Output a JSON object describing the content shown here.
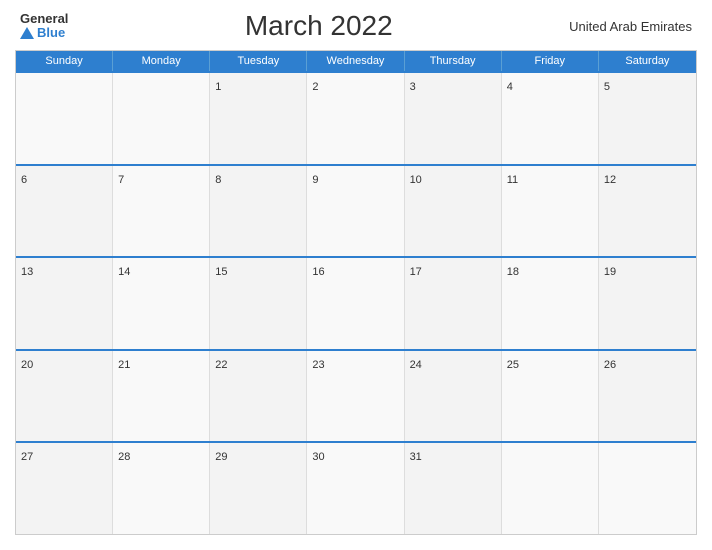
{
  "header": {
    "logo_general": "General",
    "logo_blue": "Blue",
    "title": "March 2022",
    "country": "United Arab Emirates"
  },
  "days_of_week": [
    "Sunday",
    "Monday",
    "Tuesday",
    "Wednesday",
    "Thursday",
    "Friday",
    "Saturday"
  ],
  "weeks": [
    [
      {
        "day": "",
        "empty": true
      },
      {
        "day": "",
        "empty": true
      },
      {
        "day": "1",
        "empty": false
      },
      {
        "day": "2",
        "empty": false
      },
      {
        "day": "3",
        "empty": false
      },
      {
        "day": "4",
        "empty": false
      },
      {
        "day": "5",
        "empty": false
      }
    ],
    [
      {
        "day": "6",
        "empty": false
      },
      {
        "day": "7",
        "empty": false
      },
      {
        "day": "8",
        "empty": false
      },
      {
        "day": "9",
        "empty": false
      },
      {
        "day": "10",
        "empty": false
      },
      {
        "day": "11",
        "empty": false
      },
      {
        "day": "12",
        "empty": false
      }
    ],
    [
      {
        "day": "13",
        "empty": false
      },
      {
        "day": "14",
        "empty": false
      },
      {
        "day": "15",
        "empty": false
      },
      {
        "day": "16",
        "empty": false
      },
      {
        "day": "17",
        "empty": false
      },
      {
        "day": "18",
        "empty": false
      },
      {
        "day": "19",
        "empty": false
      }
    ],
    [
      {
        "day": "20",
        "empty": false
      },
      {
        "day": "21",
        "empty": false
      },
      {
        "day": "22",
        "empty": false
      },
      {
        "day": "23",
        "empty": false
      },
      {
        "day": "24",
        "empty": false
      },
      {
        "day": "25",
        "empty": false
      },
      {
        "day": "26",
        "empty": false
      }
    ],
    [
      {
        "day": "27",
        "empty": false
      },
      {
        "day": "28",
        "empty": false
      },
      {
        "day": "29",
        "empty": false
      },
      {
        "day": "30",
        "empty": false
      },
      {
        "day": "31",
        "empty": false
      },
      {
        "day": "",
        "empty": true
      },
      {
        "day": "",
        "empty": true
      }
    ]
  ]
}
